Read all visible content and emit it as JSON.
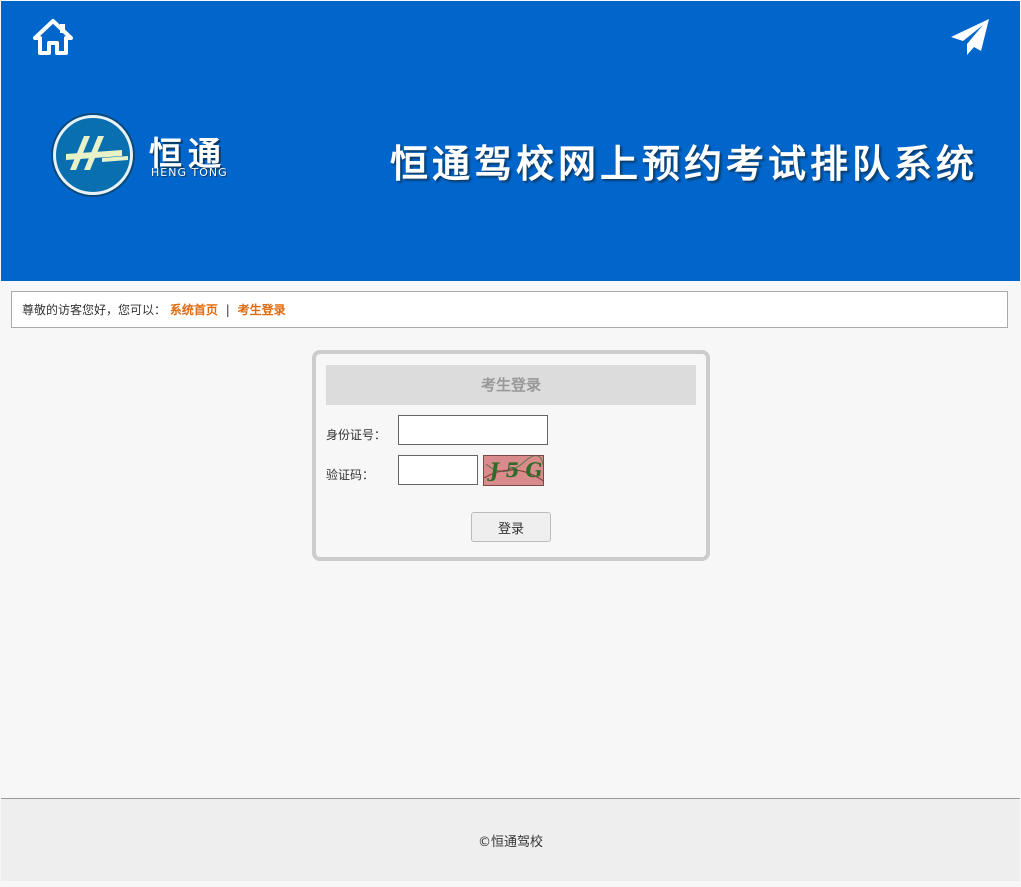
{
  "header": {
    "home_icon": "home-icon",
    "send_icon": "paper-plane-icon",
    "logo": {
      "cn": "恒通",
      "en": "HENG TONG"
    },
    "site_title": "恒通驾校网上预约考试排队系统"
  },
  "notice": {
    "greeting": "尊敬的访客您好，您可以：",
    "links": [
      "系统首页",
      "考生登录"
    ],
    "separator": "|",
    "link_color": "#e06b10"
  },
  "login": {
    "title": "考生登录",
    "id_label": "身份证号：",
    "id_value": "",
    "captcha_label": "验证码：",
    "captcha_value": "",
    "captcha_text": "J5G",
    "submit_label": "登录"
  },
  "footer": {
    "copyright": "©恒通驾校"
  },
  "colors": {
    "header_bg": "#0066cc",
    "page_bg": "#f7f7f7",
    "footer_bg": "#eeeeee"
  }
}
